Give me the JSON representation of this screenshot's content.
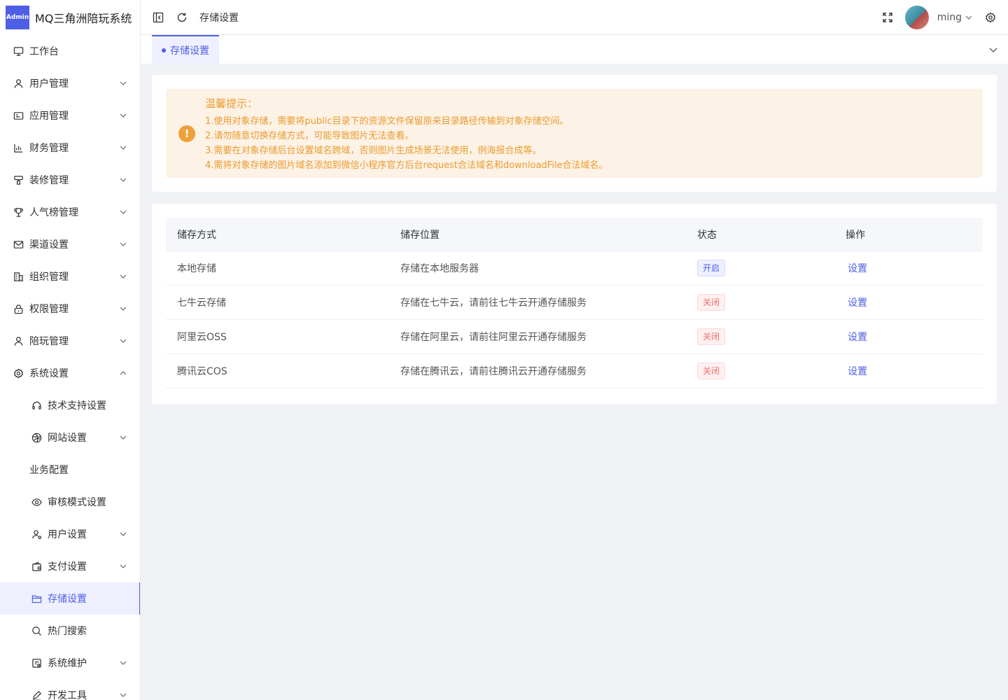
{
  "logo": {
    "badge": "Admin",
    "title": "MQ三角洲陪玩系统"
  },
  "sidebar": {
    "items": [
      {
        "label": "工作台",
        "icon": "monitor-icon",
        "expandable": false
      },
      {
        "label": "用户管理",
        "icon": "user-icon",
        "expandable": true
      },
      {
        "label": "应用管理",
        "icon": "app-icon",
        "expandable": true
      },
      {
        "label": "财务管理",
        "icon": "chart-icon",
        "expandable": true
      },
      {
        "label": "装修管理",
        "icon": "paint-icon",
        "expandable": true
      },
      {
        "label": "人气榜管理",
        "icon": "trophy-icon",
        "expandable": true
      },
      {
        "label": "渠道设置",
        "icon": "mail-icon",
        "expandable": true
      },
      {
        "label": "组织管理",
        "icon": "building-icon",
        "expandable": true
      },
      {
        "label": "权限管理",
        "icon": "lock-icon",
        "expandable": true
      },
      {
        "label": "陪玩管理",
        "icon": "user-icon",
        "expandable": true
      },
      {
        "label": "系统设置",
        "icon": "gear-icon",
        "expandable": true,
        "expanded": true
      }
    ],
    "sub_items": [
      {
        "label": "技术支持设置",
        "icon": "headset-icon",
        "expandable": false
      },
      {
        "label": "网站设置",
        "icon": "globe-icon",
        "expandable": true
      },
      {
        "label": "业务配置",
        "icon": "",
        "expandable": false
      },
      {
        "label": "审核模式设置",
        "icon": "eye-icon",
        "expandable": false
      },
      {
        "label": "用户设置",
        "icon": "user-settings-icon",
        "expandable": true
      },
      {
        "label": "支付设置",
        "icon": "wallet-icon",
        "expandable": true
      },
      {
        "label": "存储设置",
        "icon": "folder-icon",
        "expandable": false,
        "active": true
      },
      {
        "label": "热门搜索",
        "icon": "search-icon",
        "expandable": false
      },
      {
        "label": "系统维护",
        "icon": "maintenance-icon",
        "expandable": true
      },
      {
        "label": "开发工具",
        "icon": "pen-icon",
        "expandable": true
      }
    ]
  },
  "header": {
    "breadcrumb": "存储设置",
    "username": "ming"
  },
  "tabs": [
    {
      "label": "存储设置",
      "active": true
    }
  ],
  "notice": {
    "title": "温馨提示：",
    "lines": [
      "1.使用对象存储，需要将public目录下的资源文件保留原来目录路径传输到对象存储空间。",
      "2.请勿随意切换存储方式，可能导致图片无法查看。",
      "3.需要在对象存储后台设置域名跨域，否则图片生成场景无法使用，例海报合成等。",
      "4.需将对象存储的图片域名添加到微信小程序官方后台request合法域名和downloadFile合法域名。"
    ]
  },
  "table": {
    "headers": [
      "储存方式",
      "储存位置",
      "状态",
      "操作"
    ],
    "rows": [
      {
        "method": "本地存储",
        "location": "存储在本地服务器",
        "status": "开启",
        "status_on": true,
        "action": "设置"
      },
      {
        "method": "七牛云存储",
        "location": "存储在七牛云，请前往七牛云开通存储服务",
        "status": "关闭",
        "status_on": false,
        "action": "设置"
      },
      {
        "method": "阿里云OSS",
        "location": "存储在阿里云，请前往阿里云开通存储服务",
        "status": "关闭",
        "status_on": false,
        "action": "设置"
      },
      {
        "method": "腾讯云COS",
        "location": "存储在腾讯云，请前往腾讯云开通存储服务",
        "status": "关闭",
        "status_on": false,
        "action": "设置"
      }
    ]
  },
  "colors": {
    "accent": "#4e5fe6",
    "warning": "#ea9b2e",
    "danger": "#f56c6c"
  }
}
